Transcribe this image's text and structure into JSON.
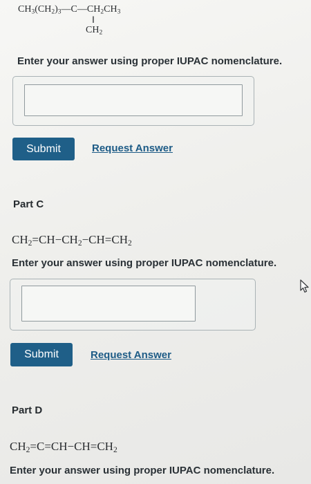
{
  "part_b": {
    "formula": {
      "prefix": "CH",
      "s1": "3",
      "mid1": "(CH",
      "s2": "2",
      "mid2": ")",
      "s3": "3",
      "mid3": "—C—CH",
      "s4": "2",
      "mid4": "CH",
      "s5": "3",
      "branch_bond": "‖",
      "branch": "CH",
      "branch_sub": "2"
    },
    "prompt": "Enter your answer using proper IUPAC nomenclature.",
    "answer_value": "",
    "submit_label": "Submit",
    "request_label": "Request Answer"
  },
  "part_c": {
    "title": "Part C",
    "formula": {
      "t1": "CH",
      "s1": "2",
      "t2": "=CH−CH",
      "s2": "2",
      "t3": "−CH=CH",
      "s3": "2"
    },
    "prompt": "Enter your answer using proper IUPAC nomenclature.",
    "answer_value": "",
    "submit_label": "Submit",
    "request_label": "Request Answer",
    "cursor_icon": "mouse-pointer-icon"
  },
  "part_d": {
    "title": "Part D",
    "formula": {
      "t1": "CH",
      "s1": "2",
      "t2": "=C=CH−CH=CH",
      "s2": "2"
    },
    "prompt": "Enter your answer using proper IUPAC nomenclature."
  }
}
